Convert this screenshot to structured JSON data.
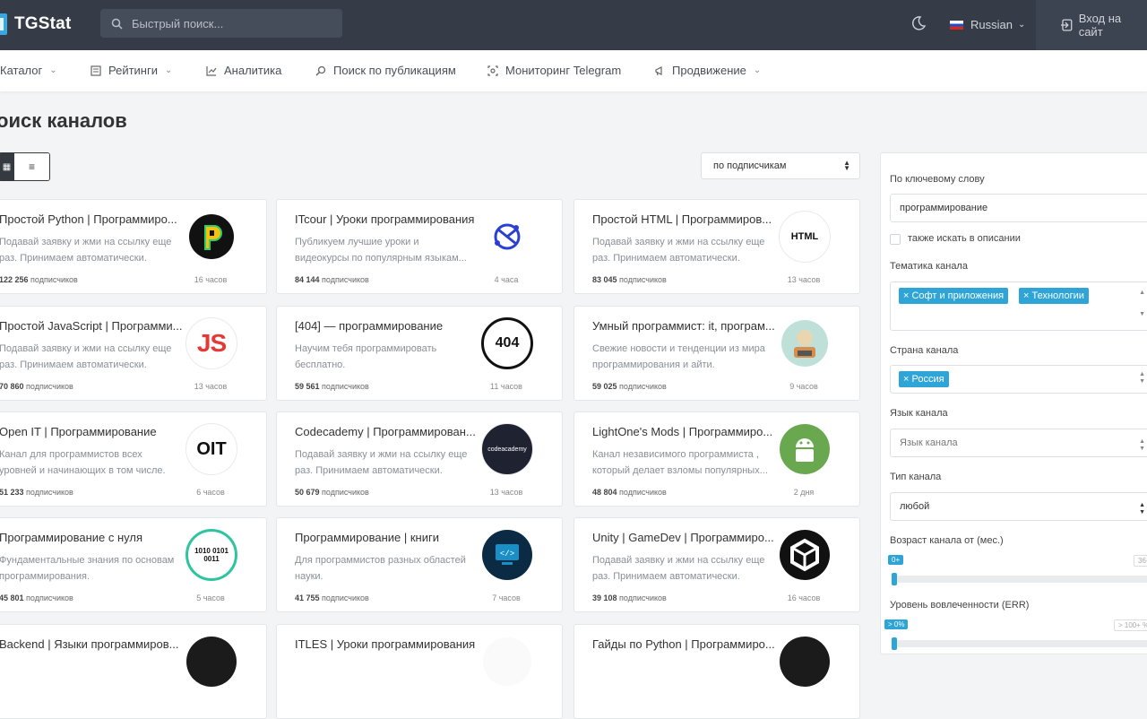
{
  "header": {
    "logo_text": "TGStat",
    "search_placeholder": "Быстрый поиск...",
    "language": "Russian",
    "login_label": "Вход на сайт"
  },
  "nav": {
    "items": [
      {
        "label": "Каталог",
        "icon": "list-icon",
        "dropdown": true
      },
      {
        "label": "Рейтинги",
        "icon": "ratings-icon",
        "dropdown": true
      },
      {
        "label": "Аналитика",
        "icon": "chart-line-icon",
        "dropdown": false
      },
      {
        "label": "Поиск по публикациям",
        "icon": "search-icon",
        "dropdown": false
      },
      {
        "label": "Мониторинг Telegram",
        "icon": "monitor-icon",
        "dropdown": false
      },
      {
        "label": "Продвижение",
        "icon": "megaphone-icon",
        "dropdown": true
      }
    ]
  },
  "page": {
    "title": "оиск каналов",
    "sort_label": "по подписчикам"
  },
  "channels": [
    {
      "title": "Простой Python | Программиро...",
      "desc1": "Подавай заявку и жми на ссылку еще",
      "desc2": "раз. Принимаем автоматически.",
      "subs": "122 256",
      "subs_label": "подписчиков",
      "time": "16 часов",
      "avatar": "python-logo"
    },
    {
      "title": "ITcour | Уроки программирования",
      "desc1": "Публикуем лучшие уроки и",
      "desc2": "видеокурсы по популярным языкам...",
      "subs": "84 144",
      "subs_label": "подписчиков",
      "time": "4 часа",
      "avatar": "itcour-logo"
    },
    {
      "title": "Простой HTML | Программиров...",
      "desc1": "Подавай заявку и жми на ссылку еще",
      "desc2": "раз. Принимаем автоматически.",
      "subs": "83 045",
      "subs_label": "подписчиков",
      "time": "13 часов",
      "avatar": "html-logo",
      "avatar_text": "HTML"
    },
    {
      "title": "Простой JavaScript | Программи...",
      "desc1": "Подавай заявку и жми на ссылку еще",
      "desc2": "раз. Принимаем автоматически.",
      "subs": "70 860",
      "subs_label": "подписчиков",
      "time": "13 часов",
      "avatar": "js-logo",
      "avatar_text": "JS"
    },
    {
      "title": "[404] — программирование",
      "desc1": "Научим тебя программировать",
      "desc2": "бесплатно.",
      "subs": "59 561",
      "subs_label": "подписчиков",
      "time": "11 часов",
      "avatar": "404-logo",
      "avatar_text": "404"
    },
    {
      "title": "Умный программист: it, програм...",
      "desc1": "Свежие новости и тенденции из мира",
      "desc2": "программирования и айти.",
      "subs": "59 025",
      "subs_label": "подписчиков",
      "time": "9 часов",
      "avatar": "programmer-avatar"
    },
    {
      "title": "Open IT | Программирование",
      "desc1": "Канал для программистов всех",
      "desc2": "уровней и начинающих в том числе.",
      "subs": "51 233",
      "subs_label": "подписчиков",
      "time": "6 часов",
      "avatar": "oit-logo",
      "avatar_text": "OIT"
    },
    {
      "title": "Codecademy | Программирован...",
      "desc1": "Подавай заявку и жми на ссылку еще",
      "desc2": "раз. Принимаем автоматически.",
      "subs": "50 679",
      "subs_label": "подписчиков",
      "time": "13 часов",
      "avatar": "codecademy-logo",
      "avatar_text": "codeacademy"
    },
    {
      "title": "LightOne's Mods | Программиро...",
      "desc1": "Канал независимого программиста ,",
      "desc2": "который делает взломы популярных...",
      "subs": "48 804",
      "subs_label": "подписчиков",
      "time": "2 дня",
      "avatar": "android-logo"
    },
    {
      "title": "Программирование с нуля",
      "desc1": "Фундаментальные знания по основам",
      "desc2": "программирования.",
      "subs": "45 801",
      "subs_label": "подписчиков",
      "time": "5 часов",
      "avatar": "binary-logo",
      "avatar_text": "1010 0101 0011"
    },
    {
      "title": "Программирование | книги",
      "desc1": "Для программистов разных областей",
      "desc2": "науки.",
      "subs": "41 755",
      "subs_label": "подписчиков",
      "time": "7 часов",
      "avatar": "code-monitor-logo"
    },
    {
      "title": "Unity | GameDev | Программиро...",
      "desc1": "Подавай заявку и жми на ссылку еще",
      "desc2": "раз. Принимаем автоматически.",
      "subs": "39 108",
      "subs_label": "подписчиков",
      "time": "16 часов",
      "avatar": "unity-logo"
    },
    {
      "title": "Backend | Языки программиров...",
      "desc1": "",
      "desc2": "",
      "subs": "",
      "subs_label": "",
      "time": "",
      "avatar": "dark-logo"
    },
    {
      "title": "ITLES | Уроки программирования",
      "desc1": "",
      "desc2": "",
      "subs": "",
      "subs_label": "",
      "time": "",
      "avatar": "plain-logo"
    },
    {
      "title": "Гайды по Python | Программиро...",
      "desc1": "",
      "desc2": "",
      "subs": "",
      "subs_label": "",
      "time": "",
      "avatar": "dark-logo"
    }
  ],
  "filters": {
    "keyword_label": "По ключевому слову",
    "keyword_value": "программирование",
    "search_desc_label": "также искать в описании",
    "topic_label": "Тематика канала",
    "topic_tags": [
      "× Софт и приложения",
      "× Технологии"
    ],
    "country_label": "Страна канала",
    "country_tags": [
      "× Россия"
    ],
    "language_label": "Язык канала",
    "language_placeholder": "Язык канала",
    "type_label": "Тип канала",
    "type_value": "любой",
    "age_label": "Возраст канала от (мес.)",
    "age_min": "0+",
    "age_max": "36+",
    "err_label": "Уровень вовлеченности (ERR)",
    "err_min": "> 0%",
    "err_max": "> 100+ %"
  }
}
